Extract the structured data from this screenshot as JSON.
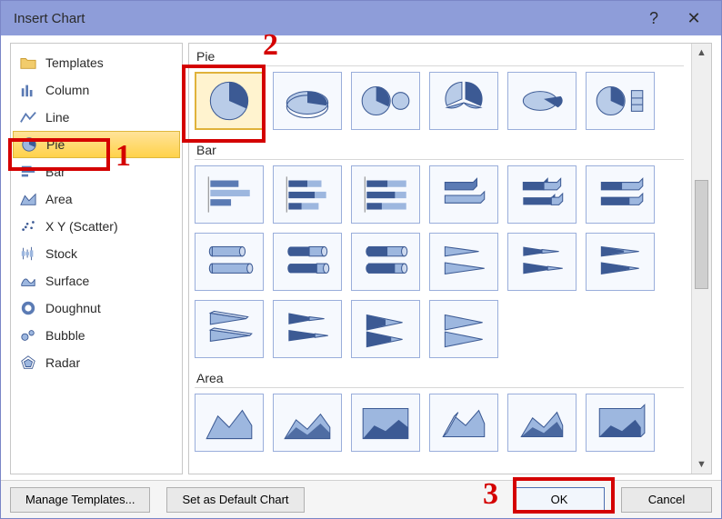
{
  "title": "Insert Chart",
  "help_glyph": "?",
  "close_glyph": "✕",
  "sidebar": {
    "items": [
      {
        "label": "Templates",
        "icon": "folder"
      },
      {
        "label": "Column",
        "icon": "column"
      },
      {
        "label": "Line",
        "icon": "line"
      },
      {
        "label": "Pie",
        "icon": "pie",
        "selected": true
      },
      {
        "label": "Bar",
        "icon": "bar"
      },
      {
        "label": "Area",
        "icon": "area"
      },
      {
        "label": "X Y (Scatter)",
        "icon": "scatter"
      },
      {
        "label": "Stock",
        "icon": "stock"
      },
      {
        "label": "Surface",
        "icon": "surface"
      },
      {
        "label": "Doughnut",
        "icon": "doughnut"
      },
      {
        "label": "Bubble",
        "icon": "bubble"
      },
      {
        "label": "Radar",
        "icon": "radar"
      }
    ]
  },
  "main": {
    "sections": [
      {
        "label": "Pie",
        "tiles": [
          "pie-2d",
          "pie-3d",
          "pie-of-pie",
          "pie-exploded",
          "pie-exploded-3d",
          "bar-of-pie"
        ],
        "selected_index": 0
      },
      {
        "label": "Bar",
        "tiles": [
          "bar-clustered",
          "bar-stacked",
          "bar-stacked100",
          "bar-3d-clustered",
          "bar-3d-stacked",
          "bar-3d-stacked100",
          "bar-cyl-clustered",
          "bar-cyl-stacked-a",
          "bar-cyl-stacked-b",
          "bar-cone-clustered",
          "bar-cone-stacked-a",
          "bar-cone-stacked-b",
          "bar-pyr-clustered",
          "bar-pyr-stacked-a",
          "bar-pyr-a",
          "bar-pyr-b"
        ]
      },
      {
        "label": "Area",
        "tiles": [
          "area-2d",
          "area-stacked",
          "area-stacked100",
          "area-3d",
          "area-3d-stacked",
          "area-3d-stacked100"
        ]
      }
    ]
  },
  "footer": {
    "manage_templates": "Manage Templates...",
    "set_default": "Set as Default Chart",
    "ok": "OK",
    "cancel": "Cancel"
  },
  "annotations": {
    "one": "1",
    "two": "2",
    "three": "3"
  },
  "colors": {
    "accent": "#5b7bb4",
    "accent_dark": "#3c5a94",
    "highlight": "#d40000"
  }
}
